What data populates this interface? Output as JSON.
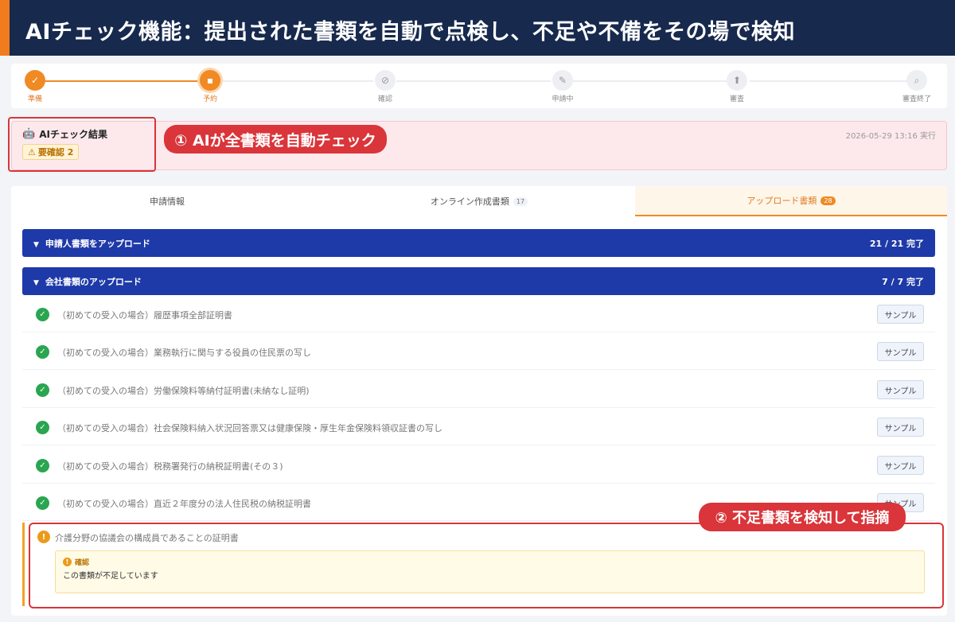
{
  "banner": {
    "title": "AIチェック機能：提出された書類を自動で点検し、不足や不備をその場で検知"
  },
  "steps": [
    {
      "label": "準備",
      "icon": "check-icon",
      "glyph": "✓",
      "state": "done"
    },
    {
      "label": "予約",
      "icon": "document-icon",
      "glyph": "▪",
      "state": "active"
    },
    {
      "label": "確認",
      "icon": "check-circle-icon",
      "glyph": "⊘",
      "state": "pending"
    },
    {
      "label": "申請中",
      "icon": "gavel-icon",
      "glyph": "✎",
      "state": "pending"
    },
    {
      "label": "審査",
      "icon": "upload-icon",
      "glyph": "⬆",
      "state": "pending"
    },
    {
      "label": "審査終了",
      "icon": "search-icon",
      "glyph": "⌕",
      "state": "pending"
    }
  ],
  "ai_result": {
    "title": "AIチェック結果",
    "badge": "要確認 2",
    "timestamp": "2026-05-29 13:16 実行"
  },
  "callouts": {
    "first": "① AIが全書類を自動チェック",
    "second": "② 不足書類を検知して指摘"
  },
  "tabs": [
    {
      "label": "申請情報",
      "count": ""
    },
    {
      "label": "オンライン作成書類",
      "count": "17"
    },
    {
      "label": "アップロード書類",
      "count": "28"
    }
  ],
  "sections": {
    "applicant": {
      "title": "申請人書類をアップロード",
      "status": "21 / 21 完了"
    },
    "company": {
      "title": "会社書類のアップロード",
      "status": "7 / 7 完了"
    }
  },
  "documents": [
    "（初めての受入の場合）履歴事項全部証明書",
    "（初めての受入の場合）業務執行に関与する役員の住民票の写し",
    "（初めての受入の場合）労働保険料等納付証明書(未納なし証明)",
    "（初めての受入の場合）社会保険料納入状況回答票又は健康保険・厚生年金保険料領収証書の写し",
    "（初めての受入の場合）税務署発行の納税証明書(その３)",
    "（初めての受入の場合）直近２年度分の法人住民税の納税証明書"
  ],
  "sample_label": "サンプル",
  "missing_doc": {
    "name": "介護分野の協議会の構成員であることの証明書",
    "box_title": "確認",
    "message": "この書類が不足しています"
  }
}
